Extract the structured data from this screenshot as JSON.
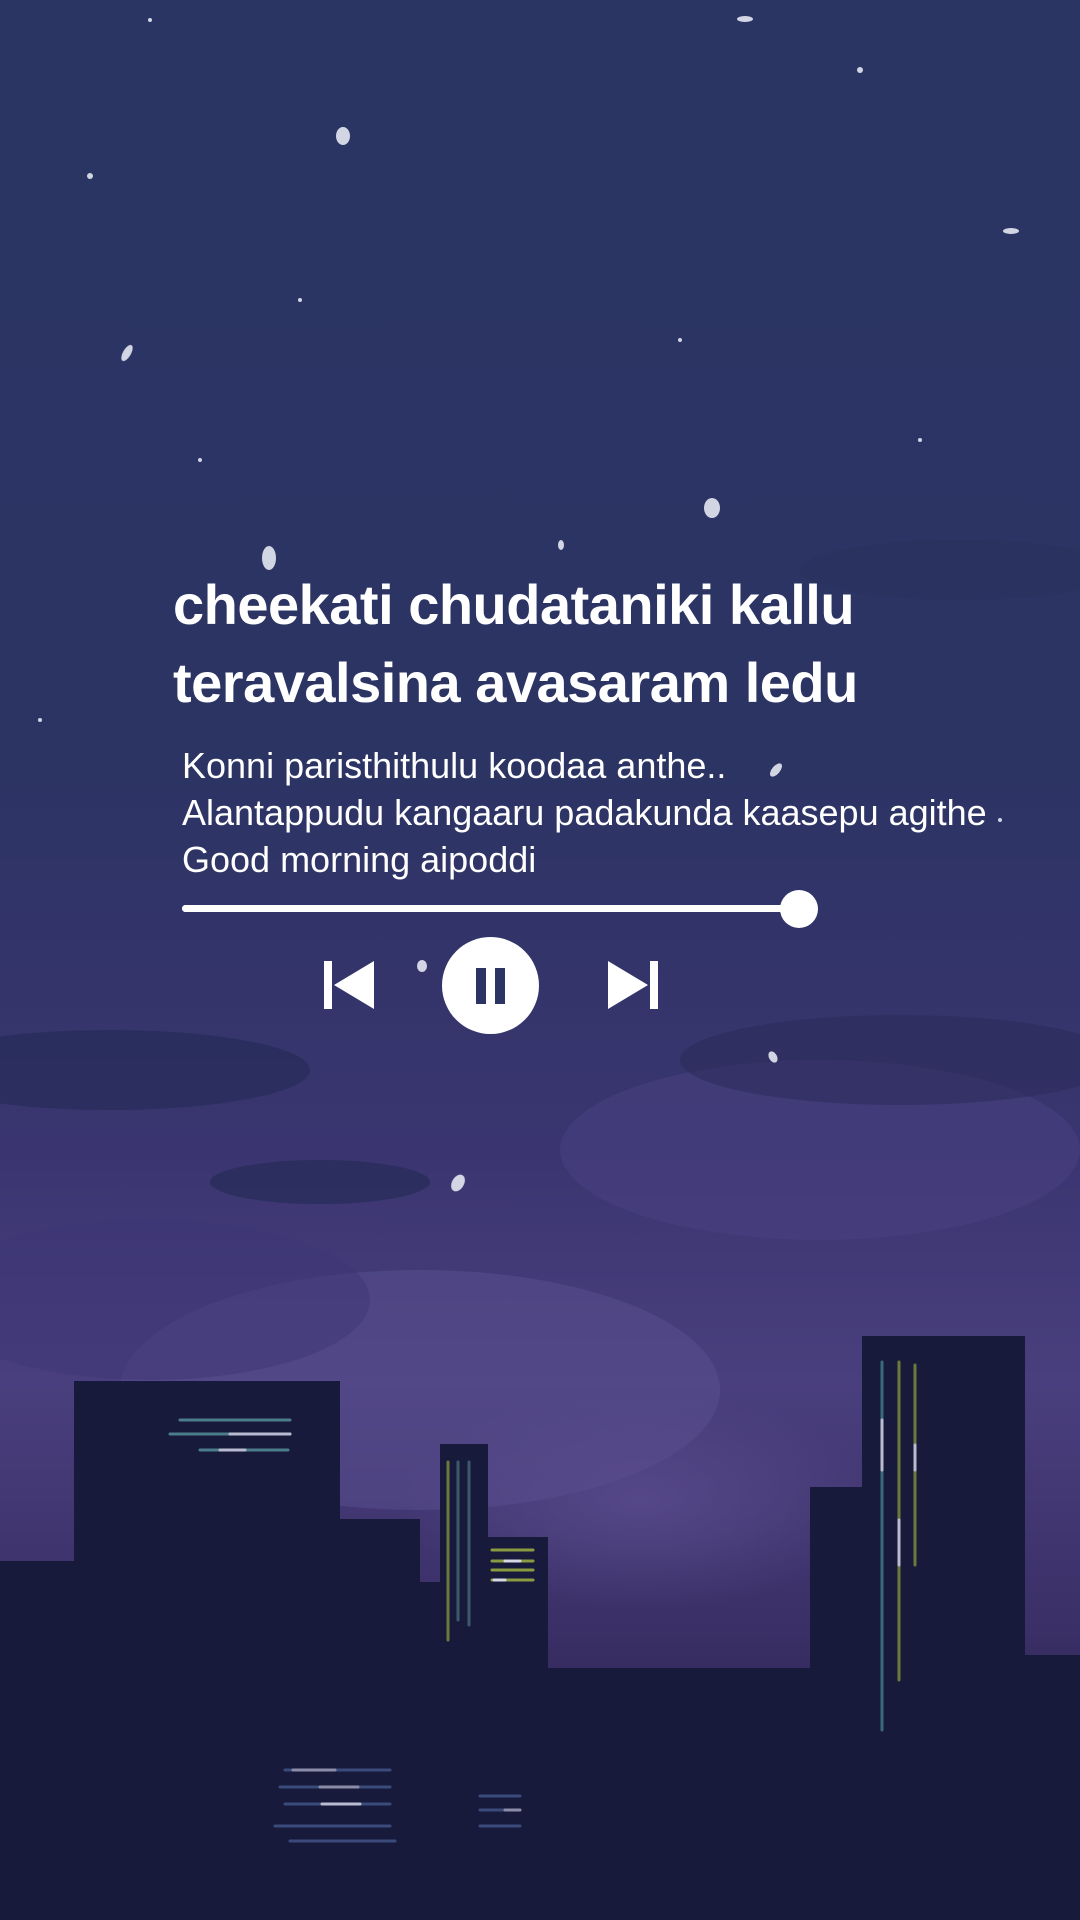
{
  "song": {
    "title_lines": [
      "cheekati chudataniki kallu",
      "teravalsina avasaram ledu"
    ],
    "lyrics": [
      "Konni paristhithulu koodaa anthe..",
      "Alantappudu kangaaru padakunda kaasepu agithe",
      "Good morning aipoddi"
    ]
  },
  "player": {
    "progress_fraction": 1.0,
    "state": "playing",
    "controls": {
      "prev_icon": "skip-previous-icon",
      "play_pause_icon": "pause-icon",
      "next_icon": "skip-next-icon"
    }
  },
  "colors": {
    "text": "#ffffff",
    "sky_top": "#2a3563",
    "sky_bottom": "#1d1a40",
    "building": "#181a3c"
  }
}
